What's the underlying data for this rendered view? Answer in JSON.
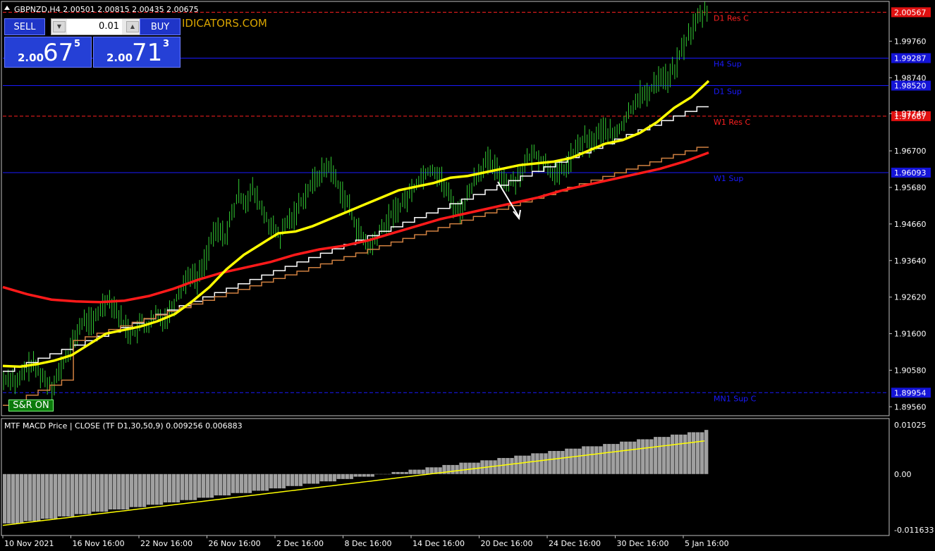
{
  "header": {
    "title": "GBPNZD,H4  2.00501 2.00815 2.00435 2.00675",
    "watermark": "IDICATORS.COM"
  },
  "trade_panel": {
    "sell_label": "SELL",
    "buy_label": "BUY",
    "lot_value": "0.01",
    "sell_prefix": "2.00",
    "sell_big": "67",
    "sell_sup": "5",
    "buy_prefix": "2.00",
    "buy_big": "71",
    "buy_sup": "3"
  },
  "sr_button": "S&R  ON",
  "colors": {
    "background": "#000000",
    "candles": "#33cc33",
    "ema_fast": "#ffff00",
    "ema_slow": "#ff1a1a",
    "step_white": "#ffffff",
    "step_orange": "#d08040",
    "sup_line": "#1a1aff",
    "res_line": "#ff2020",
    "macd_hist": "#a0a0a0",
    "macd_signal": "#ffff00"
  },
  "chart_data": [
    {
      "type": "candlestick",
      "symbol": "GBPNZD",
      "timeframe": "H4",
      "ylim": [
        1.8935,
        2.0083
      ],
      "y_ticks": [
        "1.89560",
        "1.90580",
        "1.91600",
        "1.92620",
        "1.93640",
        "1.94660",
        "1.95680",
        "1.96700",
        "1.97740",
        "1.98740",
        "1.99760"
      ],
      "x_ticks": [
        "10 Nov 2021",
        "16 Nov 16:00",
        "22 Nov 16:00",
        "26 Nov 16:00",
        "2 Dec 16:00",
        "8 Dec 16:00",
        "14 Dec 16:00",
        "20 Dec 16:00",
        "24 Dec 16:00",
        "30 Dec 16:00",
        "5 Jan 16:00"
      ],
      "close_price_badge": "2.00567",
      "levels": [
        {
          "label": "D1 Res C",
          "price": 2.00567,
          "badge": "2.00567",
          "color": "red",
          "style": "dash"
        },
        {
          "label": "H4 Sup",
          "price": 1.99287,
          "badge": "1.99287",
          "color": "blue",
          "style": "solid"
        },
        {
          "label": "D1 Sup",
          "price": 1.9852,
          "badge": "1.98520",
          "color": "blue",
          "style": "solid"
        },
        {
          "label": "W1 Res C",
          "price": 1.97667,
          "badge": "1.97667",
          "color": "red",
          "style": "dash"
        },
        {
          "label": "W1 Sup",
          "price": 1.96093,
          "badge": "1.96093",
          "color": "blue",
          "style": "solid"
        },
        {
          "label": "MN1 Sup C",
          "price": 1.89954,
          "badge": "1.89954",
          "color": "blue",
          "style": "dash"
        }
      ],
      "close_series": [
        1.904,
        1.902,
        1.9055,
        1.9075,
        1.906,
        1.903,
        1.9015,
        1.905,
        1.909,
        1.913,
        1.918,
        1.92,
        1.919,
        1.923,
        1.926,
        1.924,
        1.92,
        1.917,
        1.916,
        1.919,
        1.918,
        1.921,
        1.92,
        1.922,
        1.926,
        1.93,
        1.933,
        1.931,
        1.936,
        1.942,
        1.945,
        1.943,
        1.949,
        1.955,
        1.953,
        1.956,
        1.952,
        1.948,
        1.945,
        1.943,
        1.947,
        1.949,
        1.953,
        1.956,
        1.959,
        1.961,
        1.963,
        1.959,
        1.955,
        1.951,
        1.946,
        1.942,
        1.94,
        1.943,
        1.946,
        1.949,
        1.951,
        1.953,
        1.956,
        1.959,
        1.961,
        1.962,
        1.96,
        1.956,
        1.952,
        1.95,
        1.954,
        1.959,
        1.962,
        1.964,
        1.962,
        1.96,
        1.958,
        1.959,
        1.962,
        1.965,
        1.966,
        1.964,
        1.962,
        1.96,
        1.962,
        1.965,
        1.968,
        1.97,
        1.969,
        1.972,
        1.973,
        1.971,
        1.973,
        1.976,
        1.98,
        1.983,
        1.982,
        1.986,
        1.988,
        1.987,
        1.99,
        1.995,
        1.999,
        2.003,
        2.005,
        2.0065
      ],
      "ema_fast": [
        1.907,
        1.9068,
        1.9075,
        1.9085,
        1.91,
        1.913,
        1.916,
        1.917,
        1.918,
        1.9195,
        1.9215,
        1.925,
        1.929,
        1.934,
        1.938,
        1.941,
        1.944,
        1.9445,
        1.946,
        1.948,
        1.95,
        1.952,
        1.954,
        1.956,
        1.957,
        1.958,
        1.9595,
        1.96,
        1.961,
        1.962,
        1.963,
        1.9635,
        1.964,
        1.965,
        1.967,
        1.969,
        1.97,
        1.972,
        1.975,
        1.979,
        1.982,
        1.9865
      ],
      "ema_slow": [
        1.929,
        1.927,
        1.9255,
        1.925,
        1.9248,
        1.9252,
        1.9265,
        1.9285,
        1.931,
        1.933,
        1.9345,
        1.936,
        1.938,
        1.9395,
        1.9405,
        1.942,
        1.944,
        1.946,
        1.948,
        1.9495,
        1.951,
        1.9525,
        1.954,
        1.956,
        1.9575,
        1.959,
        1.9605,
        1.962,
        1.964,
        1.9665
      ],
      "macd_value": "0.009256",
      "macd_signal_value": "0.006883"
    },
    {
      "type": "bar",
      "title": "MTF MACD Price | CLOSE  (TF D1,30,50,9) 0.009256 0.006883",
      "ylim": [
        -0.011633,
        0.01025
      ],
      "y_ticks": [
        "0.01025",
        "0.00",
        "-0.011633"
      ],
      "hist_start": -0.0103,
      "hist_end": 0.0092,
      "signal_start": -0.0107,
      "signal_end": 0.0069
    }
  ]
}
